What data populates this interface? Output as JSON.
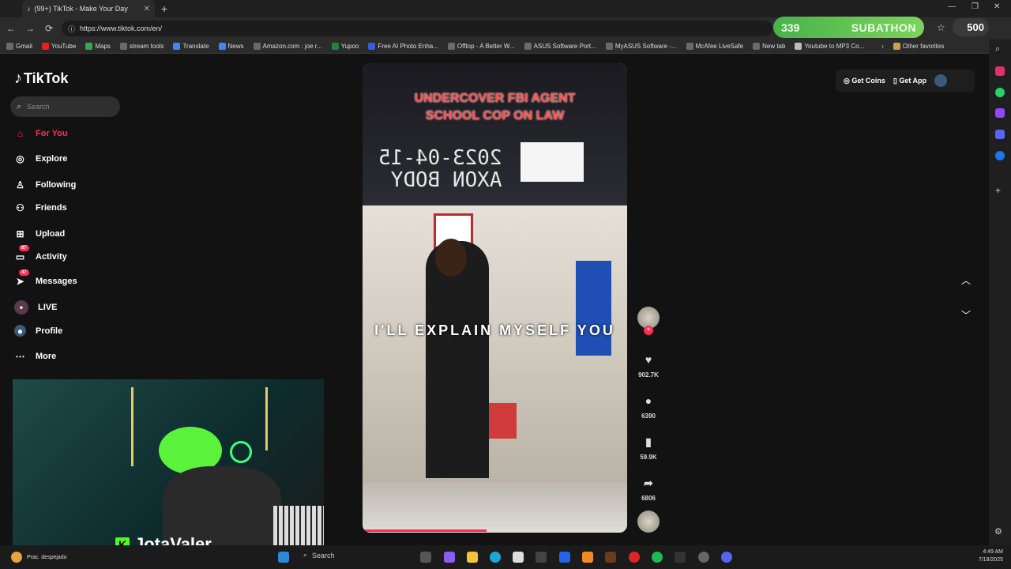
{
  "browser": {
    "tab_title": "(99+) TikTok - Make Your Day",
    "url": "https://www.tiktok.com/en/",
    "bookmarks": [
      "Gmail",
      "YouTube",
      "Maps",
      "stream tools",
      "Translate",
      "News",
      "Amazon.com : joe r...",
      "Yupoo",
      "Free AI Photo Enha...",
      "Offtop - A Better W...",
      "ASUS Software Port...",
      "MyASUS Software -...",
      "McAfee LiveSafe",
      "New tab",
      "Youtube to MP3 Co..."
    ],
    "other_favorites": "Other favorites"
  },
  "overlay": {
    "sub_count": "339",
    "sub_label": "SUBATHON",
    "coin_count": "500"
  },
  "tiktok": {
    "logo": "TikTok",
    "search_placeholder": "Search",
    "nav": [
      {
        "label": "For You",
        "icon": "home-icon"
      },
      {
        "label": "Explore",
        "icon": "compass-icon"
      },
      {
        "label": "Following",
        "icon": "following-icon"
      },
      {
        "label": "Friends",
        "icon": "friends-icon"
      },
      {
        "label": "Upload",
        "icon": "upload-icon"
      },
      {
        "label": "Activity",
        "icon": "activity-icon",
        "badge": "87"
      },
      {
        "label": "Messages",
        "icon": "messages-icon",
        "badge": "47"
      },
      {
        "label": "LIVE",
        "icon": "live-icon"
      },
      {
        "label": "Profile",
        "icon": "profile-icon"
      },
      {
        "label": "More",
        "icon": "more-icon"
      }
    ],
    "get_coins": "Get Coins",
    "get_app": "Get App",
    "video": {
      "title_line1": "UNDERCOVER FBI AGENT",
      "title_line2": "SCHOOL COP ON LAW",
      "stamp_line1": "2023-04-15",
      "stamp_line2": "AXON BODY",
      "caption": "I'LL EXPLAIN MYSELF YOU",
      "progress_fraction": 0.47
    },
    "actions": {
      "likes": "902.7K",
      "comments": "6390",
      "saves": "59.9K",
      "shares": "6806"
    }
  },
  "stream": {
    "streamer_name": "JotaValer"
  },
  "taskbar": {
    "weather": "Prac. despejado",
    "search": "Search",
    "time": "4:49 AM",
    "date": "7/18/2025"
  },
  "colors": {
    "accent": "#fe2c55",
    "kick": "#53fc18",
    "subathon": "#6cc855"
  }
}
